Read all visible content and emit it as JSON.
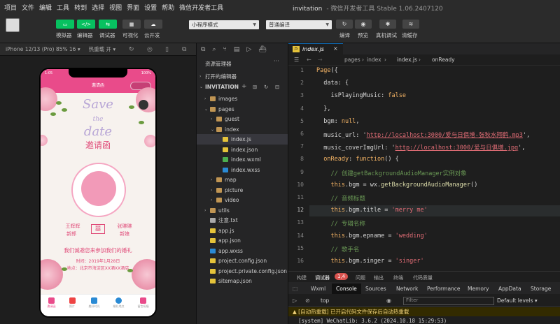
{
  "menu": [
    "项目",
    "文件",
    "编辑",
    "工具",
    "转到",
    "选择",
    "视图",
    "界面",
    "设置",
    "帮助",
    "微信开发者工具"
  ],
  "window_title": "invitation",
  "window_subtitle": "- 微信开发者工具 Stable 1.06.2407120",
  "toolbar": {
    "simulator": "模拟器",
    "editor": "编辑器",
    "debugger": "调试器",
    "visual": "可视化",
    "cloud": "云开发",
    "mode": "小程序模式",
    "compile": "普通编译",
    "compile_label": "编译",
    "preview": "预览",
    "real_debug": "真机调试",
    "clear_cache": "清缓存"
  },
  "sim": {
    "device": "iPhone 12/13 (Pro) 85% 16 ▾",
    "hot_reload": "热重载 开 ▾"
  },
  "phone": {
    "time": "1:05",
    "battery": "100%",
    "nav_title": "邀请函",
    "save": "Save",
    "the": "the",
    "date": "date",
    "invite": "邀请函",
    "groom": "王辉辉",
    "bride": "张琳琳",
    "groom_role": "新郎",
    "bride_role": "新娘",
    "message": "我们诚邀您来参加我们的婚礼",
    "time_line": "时间：2019年1月28日",
    "place_line": "地点：北京市海淀区XX酒XX酒店",
    "tabs": [
      "邀请函",
      "照片",
      "美好时光",
      "婚礼地点",
      "留言祝福"
    ]
  },
  "explorer": {
    "title": "资源管理器",
    "open_editors": "打开的编辑器",
    "project": "INVITATION",
    "items": [
      {
        "n": "images",
        "d": 1,
        "t": "folder",
        "c": ">"
      },
      {
        "n": "pages",
        "d": 1,
        "t": "folder",
        "c": "v"
      },
      {
        "n": "guest",
        "d": 2,
        "t": "folder",
        "c": ">"
      },
      {
        "n": "index",
        "d": 2,
        "t": "folder",
        "c": "v"
      },
      {
        "n": "index.js",
        "d": 3,
        "t": "js",
        "c": ""
      },
      {
        "n": "index.json",
        "d": 3,
        "t": "json",
        "c": ""
      },
      {
        "n": "index.wxml",
        "d": 3,
        "t": "wxml",
        "c": ""
      },
      {
        "n": "index.wxss",
        "d": 3,
        "t": "wxss",
        "c": ""
      },
      {
        "n": "map",
        "d": 2,
        "t": "folder",
        "c": ">"
      },
      {
        "n": "picture",
        "d": 2,
        "t": "folder",
        "c": ">"
      },
      {
        "n": "video",
        "d": 2,
        "t": "folder",
        "c": ">"
      },
      {
        "n": "utils",
        "d": 1,
        "t": "folder",
        "c": ">"
      },
      {
        "n": "注意.txt",
        "d": 1,
        "t": "txt",
        "c": ""
      },
      {
        "n": "app.js",
        "d": 1,
        "t": "js",
        "c": ""
      },
      {
        "n": "app.json",
        "d": 1,
        "t": "json",
        "c": ""
      },
      {
        "n": "app.wxss",
        "d": 1,
        "t": "wxss",
        "c": ""
      },
      {
        "n": "project.config.json",
        "d": 1,
        "t": "json",
        "c": ""
      },
      {
        "n": "project.private.config.json",
        "d": 1,
        "t": "json",
        "c": ""
      },
      {
        "n": "sitemap.json",
        "d": 1,
        "t": "json",
        "c": ""
      }
    ]
  },
  "editor": {
    "tab": "index.js",
    "crumb": [
      "pages",
      "index",
      "index.js",
      "onReady"
    ],
    "active_line": 12,
    "lines": [
      [
        [
          "kw",
          "Page"
        ],
        [
          "pr",
          "({"
        ]
      ],
      [
        [
          "pr",
          "  data: {"
        ]
      ],
      [
        [
          "pr",
          "    isPlayingMusic: "
        ],
        [
          "kw",
          "false"
        ]
      ],
      [
        [
          "pr",
          "  },"
        ]
      ],
      [
        [
          "pr",
          "  bgm: "
        ],
        [
          "kw",
          "null"
        ],
        [
          "pr",
          ","
        ]
      ],
      [
        [
          "pr",
          "  music_url: '"
        ],
        [
          "url",
          "http://localhost:3000/爱与日俱增-张秋水翔鹤.mp3"
        ],
        [
          "pr",
          "',"
        ]
      ],
      [
        [
          "pr",
          "  music_coverImgUrl: '"
        ],
        [
          "url",
          "http://localhost:3000/爱与日俱增.jpg"
        ],
        [
          "pr",
          "',"
        ]
      ],
      [
        [
          "kw",
          "  onReady"
        ],
        [
          "pr",
          ": "
        ],
        [
          "kw",
          "function"
        ],
        [
          "pr",
          "() {"
        ]
      ],
      [
        [
          "cm",
          "    // 创建getBackgroundAudioManager实例对象"
        ]
      ],
      [
        [
          "pr",
          "    "
        ],
        [
          "kw",
          "this"
        ],
        [
          "pr",
          ".bgm = wx."
        ],
        [
          "fn",
          "getBackgroundAudioManager"
        ],
        [
          "pr",
          "()"
        ]
      ],
      [
        [
          "cm",
          "    // 音频标题"
        ]
      ],
      [
        [
          "pr",
          "    "
        ],
        [
          "kw",
          "this"
        ],
        [
          "pr",
          ".bgm.title = "
        ],
        [
          "str",
          "'merry me'"
        ]
      ],
      [
        [
          "cm",
          "    // 专辑名称"
        ]
      ],
      [
        [
          "pr",
          "    "
        ],
        [
          "kw",
          "this"
        ],
        [
          "pr",
          ".bgm.epname = "
        ],
        [
          "str",
          "'wedding'"
        ]
      ],
      [
        [
          "cm",
          "    // 歌手名"
        ]
      ],
      [
        [
          "pr",
          "    "
        ],
        [
          "kw",
          "this"
        ],
        [
          "pr",
          ".bgm.singer = "
        ],
        [
          "str",
          "'singer'"
        ]
      ]
    ]
  },
  "devtools": {
    "tabs": [
      "构建",
      "调试器",
      "1,4",
      "问题",
      "输出",
      "终端",
      "代码质量"
    ],
    "panel_tabs": [
      "Wxml",
      "Console",
      "Sources",
      "Network",
      "Performance",
      "Memory",
      "AppData",
      "Storage"
    ],
    "context": "top",
    "filter": "Filter",
    "levels": "Default levels ▾",
    "log1": "[自动热重载] 已开启代码文件保存后自动热重载",
    "log2": "[system] WeChatLib: 3.6.2 (2024.10.18 15:29:53)"
  }
}
